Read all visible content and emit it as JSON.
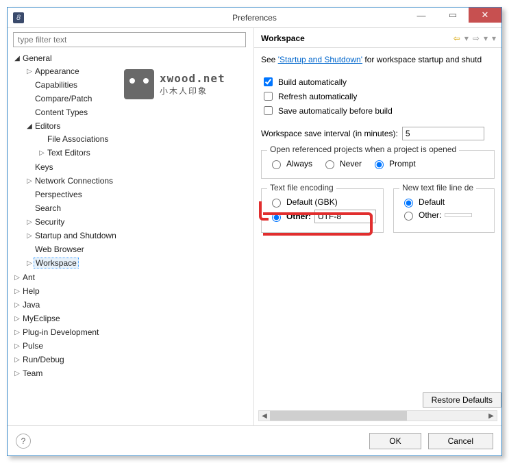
{
  "titlebar": {
    "title": "Preferences"
  },
  "filter": {
    "placeholder": "type filter text"
  },
  "tree": {
    "general": "General",
    "appearance": "Appearance",
    "capabilities": "Capabilities",
    "compare": "Compare/Patch",
    "contentTypes": "Content Types",
    "editors": "Editors",
    "fileAssoc": "File Associations",
    "textEditors": "Text Editors",
    "keys": "Keys",
    "network": "Network Connections",
    "perspectives": "Perspectives",
    "search": "Search",
    "security": "Security",
    "startup": "Startup and Shutdown",
    "webBrowser": "Web Browser",
    "workspace": "Workspace",
    "ant": "Ant",
    "help": "Help",
    "java": "Java",
    "myeclipse": "MyEclipse",
    "plugin": "Plug-in Development",
    "pulse": "Pulse",
    "rundebug": "Run/Debug",
    "team": "Team"
  },
  "page": {
    "heading": "Workspace",
    "seePrefix": "See ",
    "seeLink": "'Startup and Shutdown'",
    "seeSuffix": " for workspace startup and shutd",
    "buildAuto": "Build automatically",
    "refreshAuto": "Refresh automatically",
    "saveAuto": "Save automatically before build",
    "saveIntervalLabel": "Workspace save interval (in minutes):",
    "saveIntervalValue": "5",
    "openRef": "Open referenced projects when a project is opened",
    "always": "Always",
    "never": "Never",
    "prompt": "Prompt",
    "encodingLegend": "Text file encoding",
    "encDefault": "Default (GBK)",
    "encOther": "Other:",
    "encValue": "UTF-8",
    "lineLegend": "New text file line de",
    "lineDefault": "Default",
    "lineOther": "Other:",
    "restore": "Restore Defaults"
  },
  "buttons": {
    "ok": "OK",
    "cancel": "Cancel"
  },
  "watermark": {
    "line1": "xwood.net",
    "line2": "小木人印象"
  }
}
